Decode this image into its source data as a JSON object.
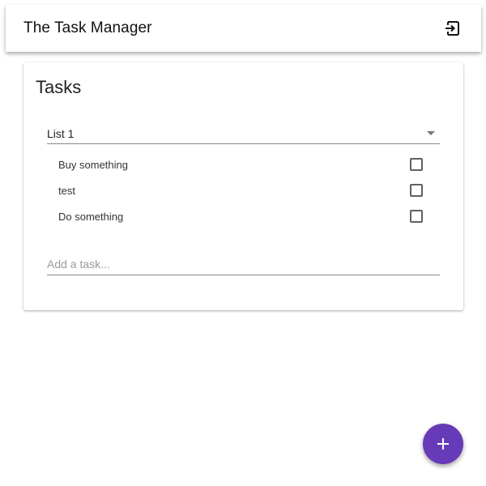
{
  "app_bar": {
    "title": "The Task Manager",
    "logout_icon": "logout-icon"
  },
  "card": {
    "title": "Tasks",
    "list_select": {
      "selected": "List 1"
    },
    "tasks": [
      {
        "label": "Buy something",
        "done": false
      },
      {
        "label": "test",
        "done": false
      },
      {
        "label": "Do something",
        "done": false
      }
    ],
    "add_task": {
      "placeholder": "Add a task...",
      "value": ""
    }
  },
  "fab": {
    "icon": "plus-icon"
  },
  "colors": {
    "accent": "#673ab7",
    "text_primary": "#222222",
    "divider": "#8a8a8a"
  }
}
